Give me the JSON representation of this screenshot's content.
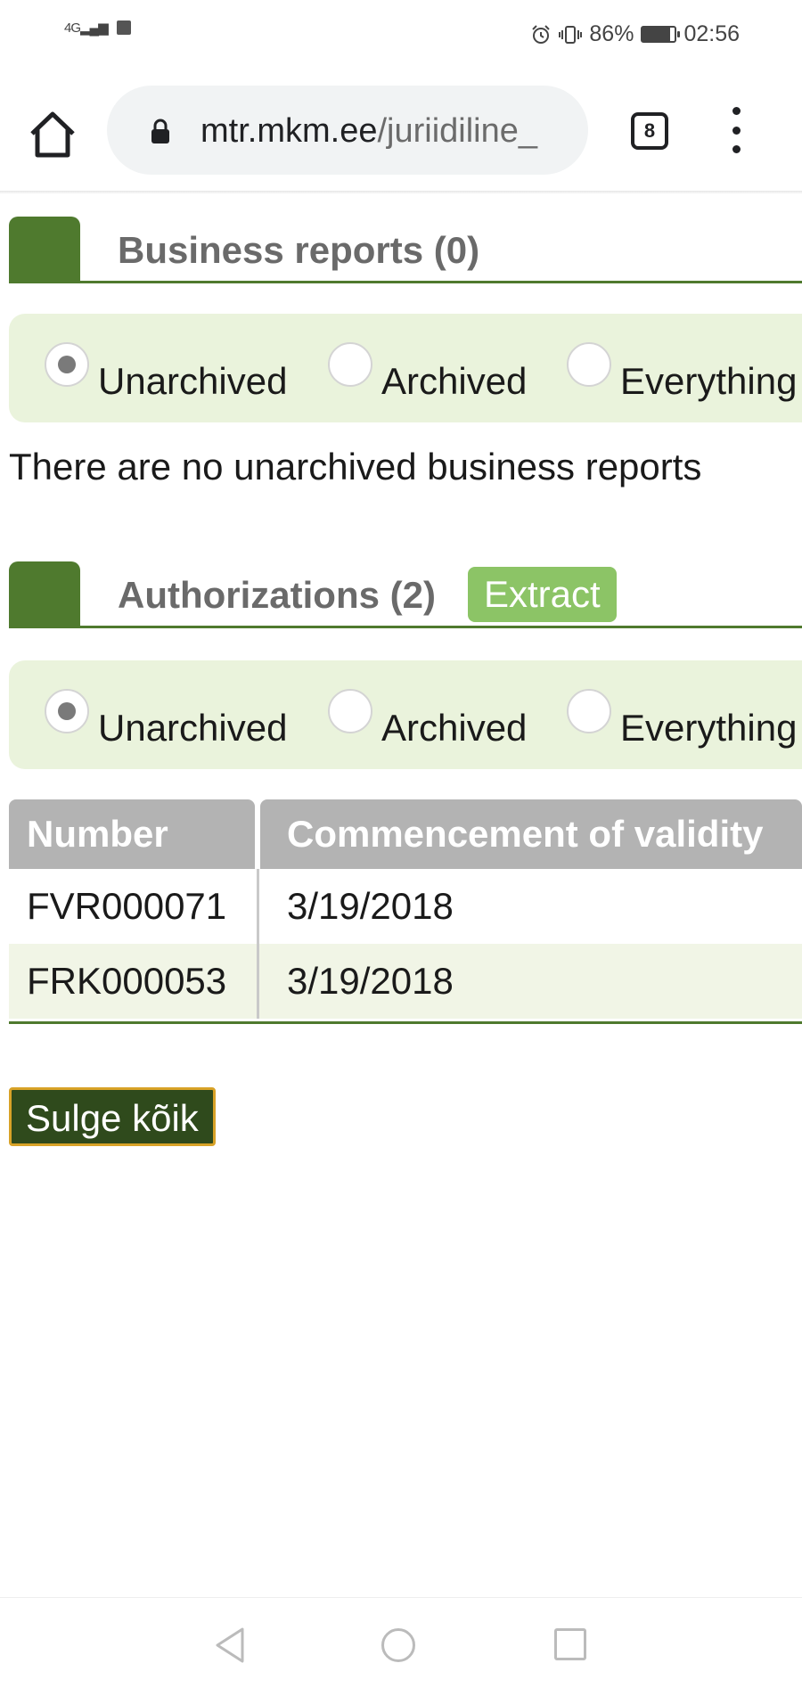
{
  "status_bar": {
    "network": "4G",
    "battery": "86%",
    "battery_level": 0.86,
    "time": "02:56",
    "icons": [
      "signal-icon",
      "notification-icon",
      "alarm-icon",
      "vibrate-icon",
      "battery-icon"
    ]
  },
  "browser": {
    "url_host": "mtr.mkm.ee",
    "url_path": "/juriidiline_",
    "tab_count": "8",
    "icons": [
      "home-icon",
      "lock-icon",
      "tabs-icon",
      "menu-icon"
    ]
  },
  "business_reports": {
    "title": "Business reports (0)",
    "filters": [
      {
        "label": "Unarchived",
        "checked": true
      },
      {
        "label": "Archived",
        "checked": false
      },
      {
        "label": "Everything",
        "checked": false
      }
    ],
    "empty_message": "There are no unarchived business reports"
  },
  "authorizations": {
    "title": "Authorizations (2)",
    "extract_label": "Extract",
    "filters": [
      {
        "label": "Unarchived",
        "checked": true
      },
      {
        "label": "Archived",
        "checked": false
      },
      {
        "label": "Everything",
        "checked": false
      }
    ],
    "columns": [
      "Number",
      "Commencement of validity"
    ],
    "rows": [
      {
        "number": "FVR000071",
        "commencement": "3/19/2018"
      },
      {
        "number": "FRK000053",
        "commencement": "3/19/2018"
      }
    ]
  },
  "close_all_label": "Sulge kõik",
  "colors": {
    "section_green": "#4f7a2e",
    "filter_bg": "#eaf3dc",
    "extract_green": "#8cc466",
    "header_gray": "#b3b3b3",
    "alt_row": "#f1f5e6",
    "button_dark_green": "#2f4a1c",
    "button_border_gold": "#d8a227"
  }
}
